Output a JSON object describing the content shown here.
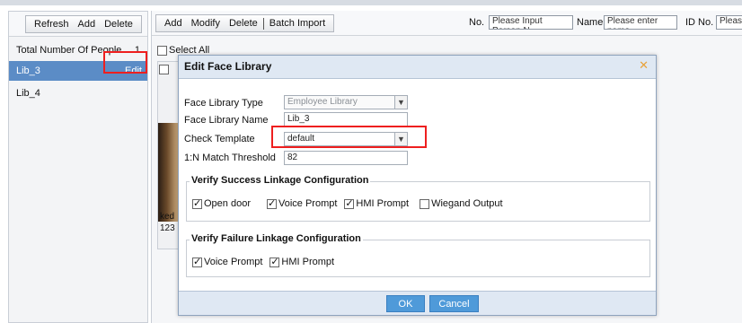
{
  "left_toolbar": {
    "refresh": "Refresh",
    "add": "Add",
    "delete": "Delete"
  },
  "libraries": {
    "total_label": "Total Number Of People",
    "total_count": "1",
    "items": [
      {
        "name": "Lib_3",
        "selected": true,
        "action": "Edit"
      },
      {
        "name": "Lib_4",
        "selected": false
      }
    ]
  },
  "right_toolbar": {
    "add": "Add",
    "modify": "Modify",
    "delete": "Delete",
    "batch_import": "Batch Import",
    "filters": {
      "no_label": "No.",
      "no_placeholder": "Please Input Person N",
      "name_label": "Name",
      "name_placeholder": "Please enter name",
      "id_label": "ID No.",
      "id_placeholder": "Pleas"
    }
  },
  "select_all": "Select All",
  "person_card": {
    "name": "ked",
    "id": "123"
  },
  "dialog": {
    "title": "Edit Face Library",
    "close_icon": "close-icon",
    "fields": {
      "type_label": "Face Library Type",
      "type_value": "Employee Library",
      "name_label": "Face Library Name",
      "name_value": "Lib_3",
      "template_label": "Check Template",
      "template_value": "default",
      "threshold_label": "1:N Match Threshold",
      "threshold_value": "82"
    },
    "success_group": {
      "legend": "Verify Success Linkage Configuration",
      "options": [
        {
          "label": "Open door",
          "checked": true
        },
        {
          "label": "Voice Prompt",
          "checked": true
        },
        {
          "label": "HMI Prompt",
          "checked": true
        },
        {
          "label": "Wiegand Output",
          "checked": false
        }
      ]
    },
    "failure_group": {
      "legend": "Verify Failure Linkage Configuration",
      "options": [
        {
          "label": "Voice Prompt",
          "checked": true
        },
        {
          "label": "HMI Prompt",
          "checked": true
        }
      ]
    },
    "ok": "OK",
    "cancel": "Cancel"
  },
  "colors": {
    "selected_row": "#5b8cc6",
    "highlight": "#ee1f1f",
    "dialog_button": "#4f9ad9",
    "dialog_header": "#dfe8f3"
  }
}
